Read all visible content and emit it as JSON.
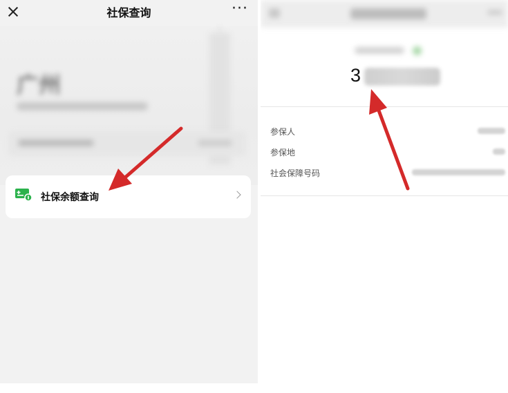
{
  "left_screen": {
    "topbar": {
      "title": "社保查询",
      "more_glyph": "···"
    },
    "hero": {
      "city": "广州"
    },
    "balance_item": {
      "label": "社保余额查询",
      "icon": "card-plus-icon"
    }
  },
  "right_screen": {
    "amount_visible_digit": "3",
    "info_rows": [
      {
        "label": "参保人"
      },
      {
        "label": "参保地"
      },
      {
        "label": "社会保障号码"
      }
    ]
  },
  "colors": {
    "accent_green": "#2bb24c",
    "annotation_red": "#d42a2a"
  }
}
